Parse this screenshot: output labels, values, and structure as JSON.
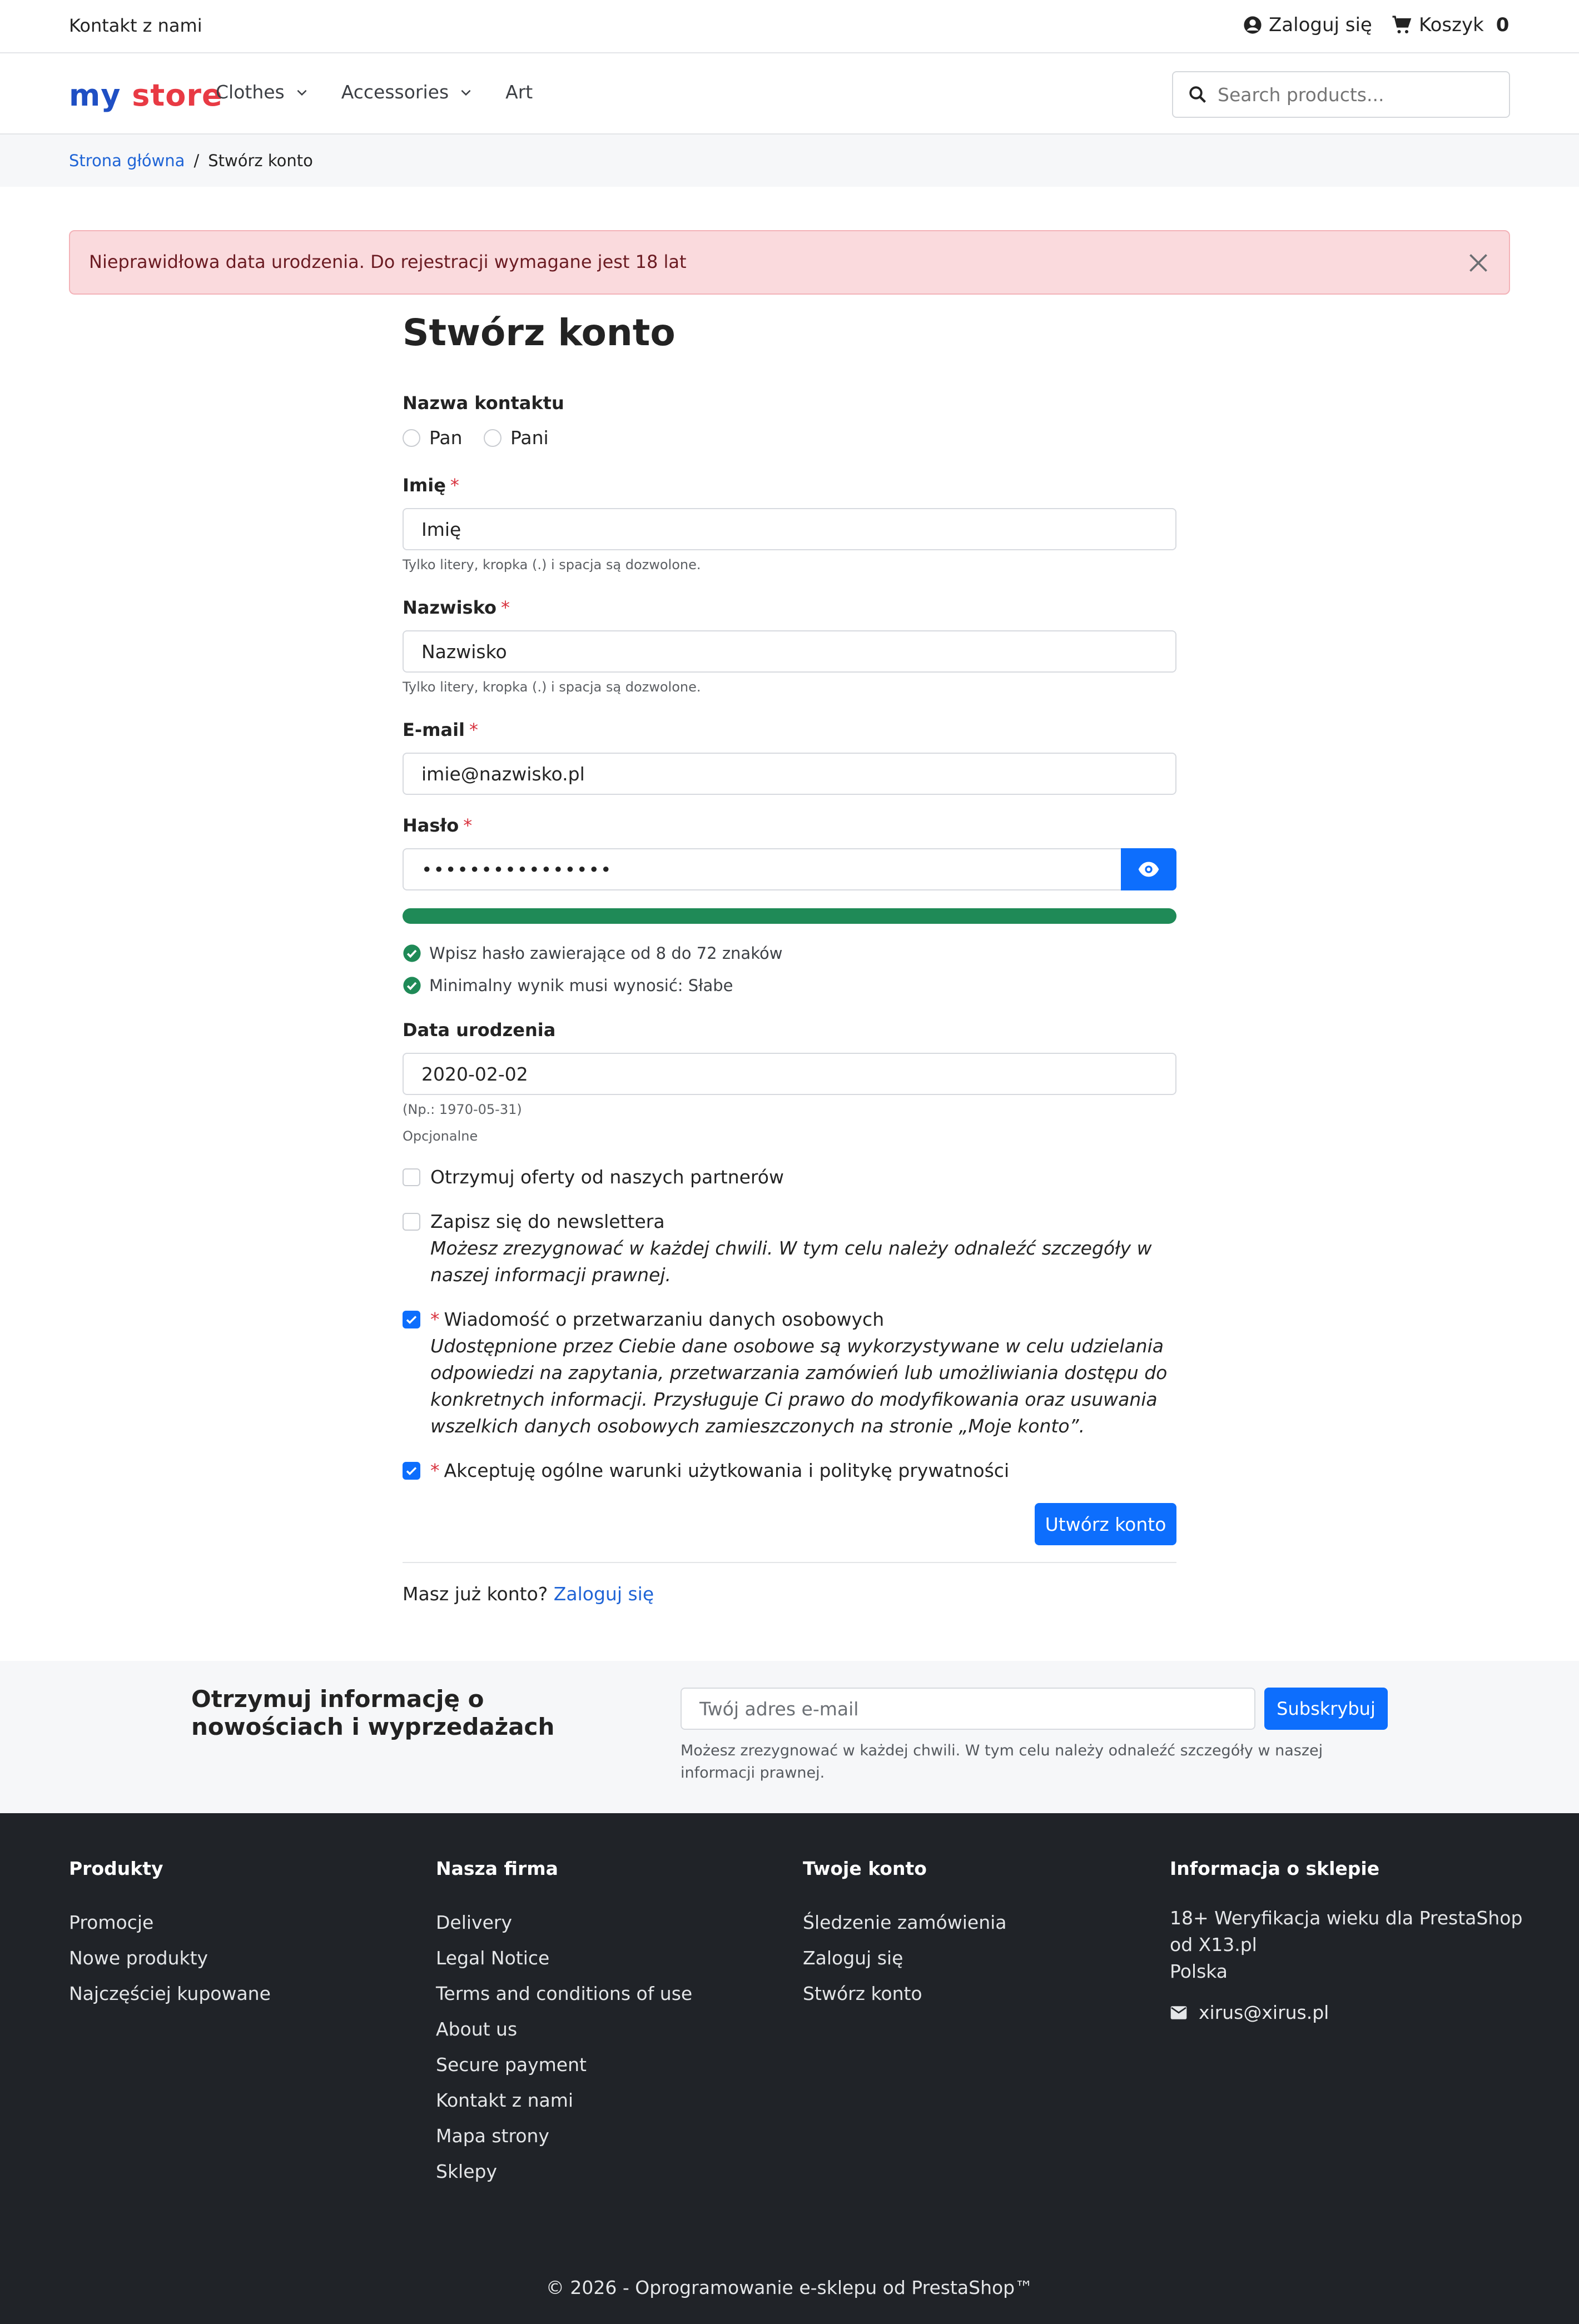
{
  "topbar": {
    "contact": "Kontakt z nami",
    "login": "Zaloguj się",
    "cart_label": "Koszyk",
    "cart_count": "0"
  },
  "header": {
    "logo_part1": "my",
    "logo_part2": "store",
    "nav": [
      {
        "label": "Clothes"
      },
      {
        "label": "Accessories"
      },
      {
        "label": "Art"
      }
    ],
    "search_placeholder": "Search products..."
  },
  "breadcrumb": {
    "home": "Strona główna",
    "sep": "/",
    "current": "Stwórz konto"
  },
  "alert": {
    "text": "Nieprawidłowa data urodzenia. Do rejestracji wymagane jest 18 lat"
  },
  "form": {
    "title": "Stwórz konto",
    "gender_label": "Nazwa kontaktu",
    "gender_options": [
      "Pan",
      "Pani"
    ],
    "firstname_label": "Imię",
    "firstname_value": "Imię",
    "firstname_hint": "Tylko litery, kropka (.) i spacja są dozwolone.",
    "lastname_label": "Nazwisko",
    "lastname_value": "Nazwisko",
    "lastname_hint": "Tylko litery, kropka (.) i spacja są dozwolone.",
    "email_label": "E-mail",
    "email_value": "imie@nazwisko.pl",
    "password_label": "Hasło",
    "password_value": "••••••••••••••••",
    "password_strength": 1.0,
    "pw_rule1": "Wpisz hasło zawierające od 8 do 72 znaków",
    "pw_rule2": "Minimalny wynik musi wynosić: Słabe",
    "birthday_label": "Data urodzenia",
    "birthday_value": "2020-02-02",
    "birthday_example": "(Np.: 1970-05-31)",
    "birthday_optional": "Opcjonalne",
    "req_mark": "*",
    "optin_label": "Otrzymuj oferty od naszych partnerów",
    "newsletter_label": "Zapisz się do newslettera",
    "newsletter_note": "Możesz zrezygnować w każdej chwili. W tym celu należy odnaleźć szczegóły w naszej informacji prawnej.",
    "privacy_label": "Wiadomość o przetwarzaniu danych osobowych",
    "privacy_note": "Udostępnione przez Ciebie dane osobowe są wykorzystywane w celu udzielania odpowiedzi na zapytania, przetwarzania zamówień lub umożliwiania dostępu do konkretnych informacji. Przysługuje Ci prawo do modyfikowania oraz usuwania wszelkich danych osobowych zamieszczonych na stronie „Moje konto”.",
    "terms_label": "Akceptuję ogólne warunki użytkowania i politykę prywatności",
    "submit": "Utwórz konto",
    "have_account": "Masz już konto?",
    "login_link": "Zaloguj się"
  },
  "newsletter": {
    "title": "Otrzymuj informację o nowościach i wyprzedażach",
    "email_placeholder": "Twój adres e-mail",
    "subscribe": "Subskrybuj",
    "note": "Możesz zrezygnować w każdej chwili. W tym celu należy odnaleźć szczegóły w naszej informacji prawnej."
  },
  "footer": {
    "products": {
      "title": "Produkty",
      "links": [
        "Promocje",
        "Nowe produkty",
        "Najczęściej kupowane"
      ]
    },
    "company": {
      "title": "Nasza firma",
      "links": [
        "Delivery",
        "Legal Notice",
        "Terms and conditions of use",
        "About us",
        "Secure payment",
        "Kontakt z nami",
        "Mapa strony",
        "Sklepy"
      ]
    },
    "account": {
      "title": "Twoje konto",
      "links": [
        "Śledzenie zamówienia",
        "Zaloguj się",
        "Stwórz konto"
      ]
    },
    "store": {
      "title": "Informacja o sklepie",
      "line1": "18+ Weryfikacja wieku dla PrestaShop",
      "line2": "od X13.pl",
      "line3": "Polska",
      "email": "xirus@xirus.pl"
    },
    "copyright": "© 2026 - Oprogramowanie e-sklepu od PrestaShop™"
  },
  "colors": {
    "accent": "#0d6efd",
    "success": "#1f8a57",
    "danger_bg": "#fadadd",
    "footer_bg": "#202328"
  }
}
